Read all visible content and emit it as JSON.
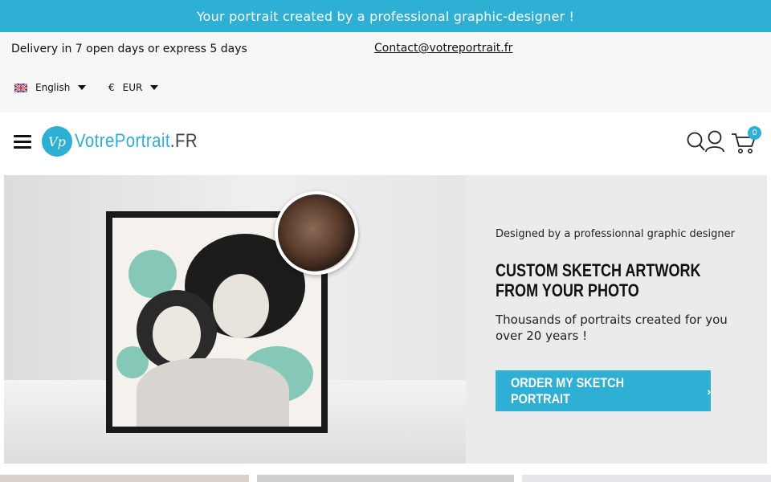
{
  "promo": {
    "text": "Your portrait created by a professional graphic-designer !"
  },
  "info": {
    "delivery": "Delivery in 7 open days or express 5 days",
    "contact": "Contact@votreportrait.fr",
    "language": "English",
    "currency_symbol": "€",
    "currency": "EUR"
  },
  "header": {
    "logo_mark": "Vp",
    "logo_main": "VotrePortrait",
    "logo_tld": ".FR",
    "cart_count": "0",
    "icons": [
      "menu-icon",
      "search-icon",
      "user-icon",
      "cart-icon"
    ]
  },
  "hero": {
    "kicker": "Designed by a professionnal graphic designer",
    "title": "CUSTOM SKETCH ARTWORK FROM YOUR PHOTO",
    "description": "Thousands of portraits created for you over 20 years !",
    "cta": "ORDER MY SKETCH PORTRAIT",
    "cta_icon": "›"
  },
  "colors": {
    "accent": "#2db0d4",
    "info_bg": "#f6f6f6",
    "hero_bg": "#ebebeb"
  }
}
